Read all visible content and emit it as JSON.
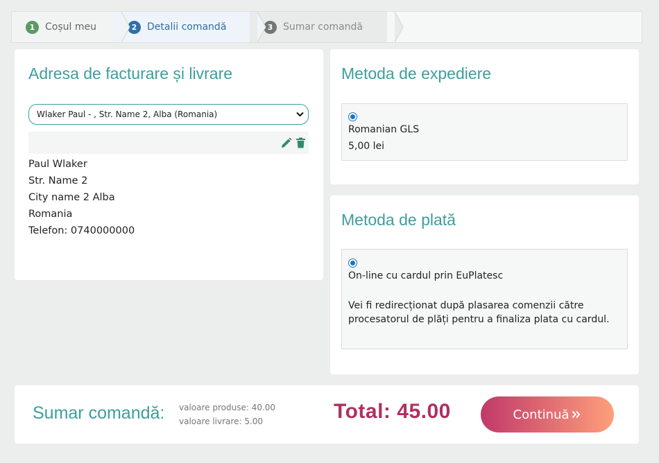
{
  "stepper": {
    "steps": [
      {
        "num": "1",
        "label": "Coșul meu"
      },
      {
        "num": "2",
        "label": "Detalii comandă"
      },
      {
        "num": "3",
        "label": "Sumar comandă"
      }
    ]
  },
  "address": {
    "title": "Adresa de facturare și livrare",
    "selected": "Wlaker Paul - , Str. Name 2, Alba (Romania)",
    "lines": [
      "Paul Wlaker",
      "Str. Name 2",
      "City name 2 Alba",
      "Romania",
      "Telefon: 0740000000"
    ]
  },
  "shipping": {
    "title": "Metoda de expediere",
    "option_name": "Romanian GLS",
    "option_price": "5,00 lei"
  },
  "payment": {
    "title": "Metoda de plată",
    "option_name": "On-line cu cardul prin EuPlatesc",
    "option_desc": "Vei fi redirecționat după plasarea comenzii către procesatorul de plăți pentru a finaliza plata cu cardul."
  },
  "summary": {
    "title": "Sumar comandă:",
    "products": "valoare produse: 40.00",
    "delivery": "valoare livrare: 5.00",
    "total": "Total: 45.00",
    "continue_label": "Continuă"
  },
  "colors": {
    "accent": "#3d9e9e",
    "total": "#b03060",
    "button_start": "#c0396a",
    "button_end": "#ff9f7b"
  }
}
